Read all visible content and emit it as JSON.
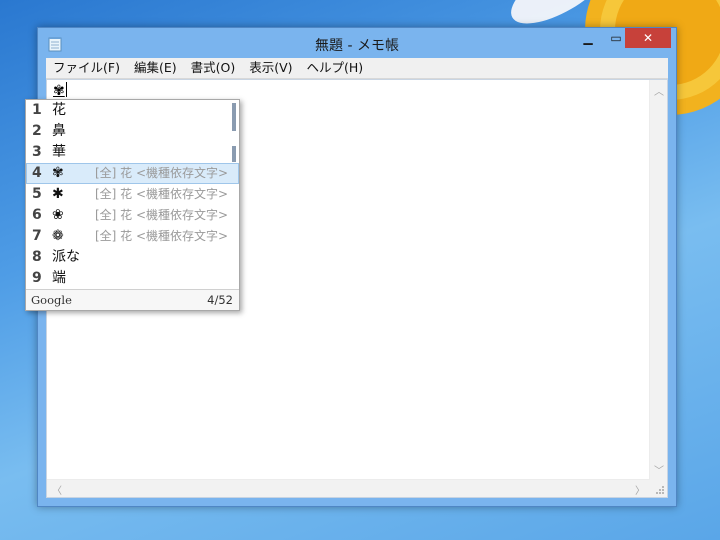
{
  "window": {
    "title": "無題 - メモ帳",
    "minimize_glyph": "▁",
    "maximize_glyph": "▭",
    "close_glyph": "✕",
    "icon": "notepad-icon"
  },
  "menu": {
    "items": [
      {
        "label": "ファイル(F)"
      },
      {
        "label": "編集(E)"
      },
      {
        "label": "書式(O)"
      },
      {
        "label": "表示(V)"
      },
      {
        "label": "ヘルプ(H)"
      }
    ]
  },
  "editor": {
    "text": "✾"
  },
  "candidates": {
    "items": [
      {
        "num": "1",
        "text": "花",
        "desc": ""
      },
      {
        "num": "2",
        "text": "鼻",
        "desc": ""
      },
      {
        "num": "3",
        "text": "華",
        "desc": ""
      },
      {
        "num": "4",
        "text": "✾",
        "desc": "[全] 花 <機種依存文字>"
      },
      {
        "num": "5",
        "text": "✱",
        "desc": "[全] 花 <機種依存文字>"
      },
      {
        "num": "6",
        "text": "❀",
        "desc": "[全] 花 <機種依存文字>"
      },
      {
        "num": "7",
        "text": "❁",
        "desc": "[全] 花 <機種依存文字>"
      },
      {
        "num": "8",
        "text": "派な",
        "desc": ""
      },
      {
        "num": "9",
        "text": "端",
        "desc": ""
      }
    ],
    "selected_index": 3,
    "brand": "Google",
    "count": "4/52"
  },
  "colors": {
    "close": "#c7413a",
    "selection": "#d9ebfa",
    "window_frame": "#7ab4ee"
  }
}
